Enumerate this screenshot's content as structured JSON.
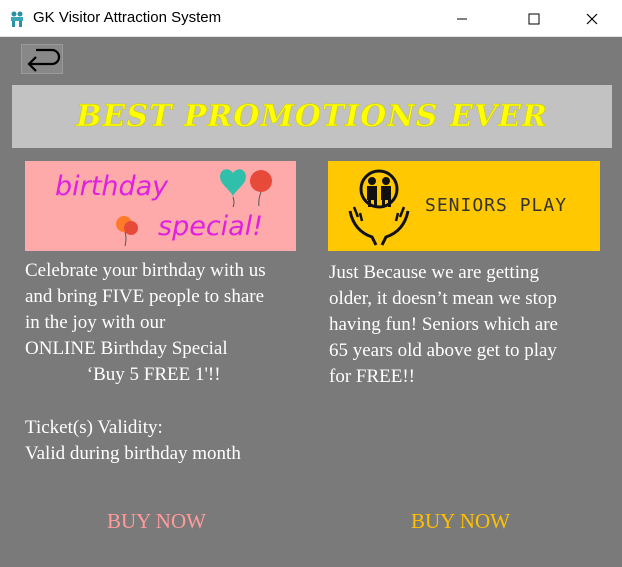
{
  "window": {
    "title": "GK Visitor Attraction System",
    "icon": "app-logo-icon",
    "controls": [
      "minimize-icon",
      "maximize-icon",
      "close-icon"
    ]
  },
  "nav": {
    "back_icon": "back-arrow-icon"
  },
  "banner": {
    "text": "BEST PROMOTIONS EVER"
  },
  "promotions": [
    {
      "image_line1": "birthday",
      "image_line2": "special!",
      "description": "Celebrate your birthday with us\nand bring FIVE people to share\nin the joy with our\nONLINE Birthday Special\n             ‘Buy 5 FREE 1'!!",
      "validity": "Ticket(s) Validity:\nValid during birthday month",
      "buy_label": "BUY NOW"
    },
    {
      "image_text": "SENIORS PLAY",
      "description": "Just Because we are getting\nolder, it doesn’t mean we stop\nhaving fun! Seniors which are\n65 years old above get to play\nfor FREE!!",
      "buy_label": "BUY NOW"
    }
  ],
  "colors": {
    "background": "#7a7a7a",
    "banner_bg": "#c2c2c2",
    "banner_text": "#ffff00",
    "birthday_card": "#ffaaaa",
    "seniors_card": "#ffc800",
    "buy_birthday": "#ff9b9b",
    "buy_seniors": "#ffc000"
  }
}
